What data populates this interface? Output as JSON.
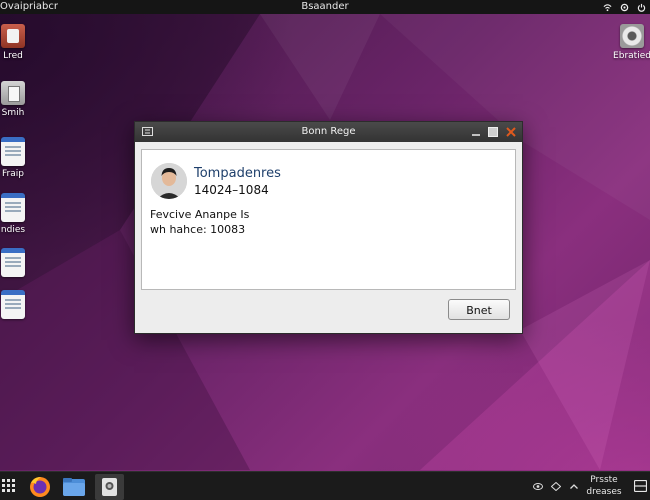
{
  "topbar": {
    "left_label": "Ovaipriabcr",
    "center_label": "Bsaander"
  },
  "desktop_icons": [
    {
      "label": "Lred",
      "icon": "toolbox-icon"
    },
    {
      "label": "Smih",
      "icon": "clipboard-icon"
    },
    {
      "label": "Fraip",
      "icon": "document-icon"
    },
    {
      "label": "ndies",
      "icon": "document-icon"
    },
    {
      "label": "",
      "icon": "document-icon"
    },
    {
      "label": "",
      "icon": "document-icon"
    },
    {
      "label": "Ebratied",
      "icon": "disk-icon"
    }
  ],
  "dialog": {
    "title": "Bonn Rege",
    "contact_name": "Tompadenres",
    "contact_number": "14024–1084",
    "line1": "Fevcive Ananpe Is",
    "line2": "wh hahce: 10083",
    "ok_label": "Bnet"
  },
  "taskbar": {
    "apps": [
      "app-grid-icon",
      "firefox-icon",
      "files-icon",
      "screenshot-icon"
    ],
    "status_line1": "Prsste",
    "status_line2": "dreases"
  },
  "colors": {
    "wallpaper_accent": "#8a2f7e",
    "close_button": "#e05a1e",
    "contact_name": "#1e3f6b"
  }
}
